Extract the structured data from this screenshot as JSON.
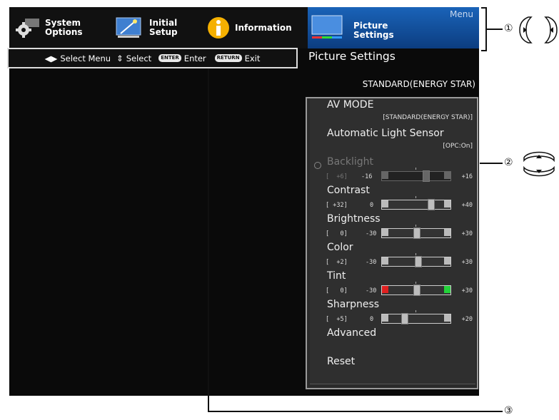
{
  "menu": {
    "title": "Menu",
    "tabs": [
      {
        "label": "System\nOptions"
      },
      {
        "label": "Initial\nSetup"
      },
      {
        "label": "Information"
      },
      {
        "label": "Picture\nSettings"
      }
    ]
  },
  "guide": {
    "select_menu": "Select Menu",
    "select": "Select",
    "enter_key": "ENTER",
    "enter": "Enter",
    "return_key": "RETURN",
    "exit": "Exit"
  },
  "picture_settings": {
    "title": "Picture Settings",
    "mode": "STANDARD(ENERGY STAR)",
    "items": [
      {
        "name": "AV MODE",
        "sub": "[STANDARD(ENERGY STAR)]"
      },
      {
        "name": "Automatic Light Sensor",
        "sub": "[OPC:On]"
      },
      {
        "name": "Backlight",
        "value": "[  +6]",
        "min": "-16",
        "max": "+16",
        "level": 0.69
      },
      {
        "name": "Contrast",
        "value": "[ +32]",
        "min": "0",
        "max": "+40",
        "level": 0.8
      },
      {
        "name": "Brightness",
        "value": "[   0]",
        "min": "-30",
        "max": "+30",
        "level": 0.5
      },
      {
        "name": "Color",
        "value": "[  +2]",
        "min": "-30",
        "max": "+30",
        "level": 0.53
      },
      {
        "name": "Tint",
        "value": "[   0]",
        "min": "-30",
        "max": "+30",
        "level": 0.5
      },
      {
        "name": "Sharpness",
        "value": "[  +5]",
        "min": "0",
        "max": "+20",
        "level": 0.25
      },
      {
        "name": "Advanced"
      },
      {
        "name": "Reset"
      }
    ]
  },
  "callouts": [
    "①",
    "②",
    "③"
  ]
}
